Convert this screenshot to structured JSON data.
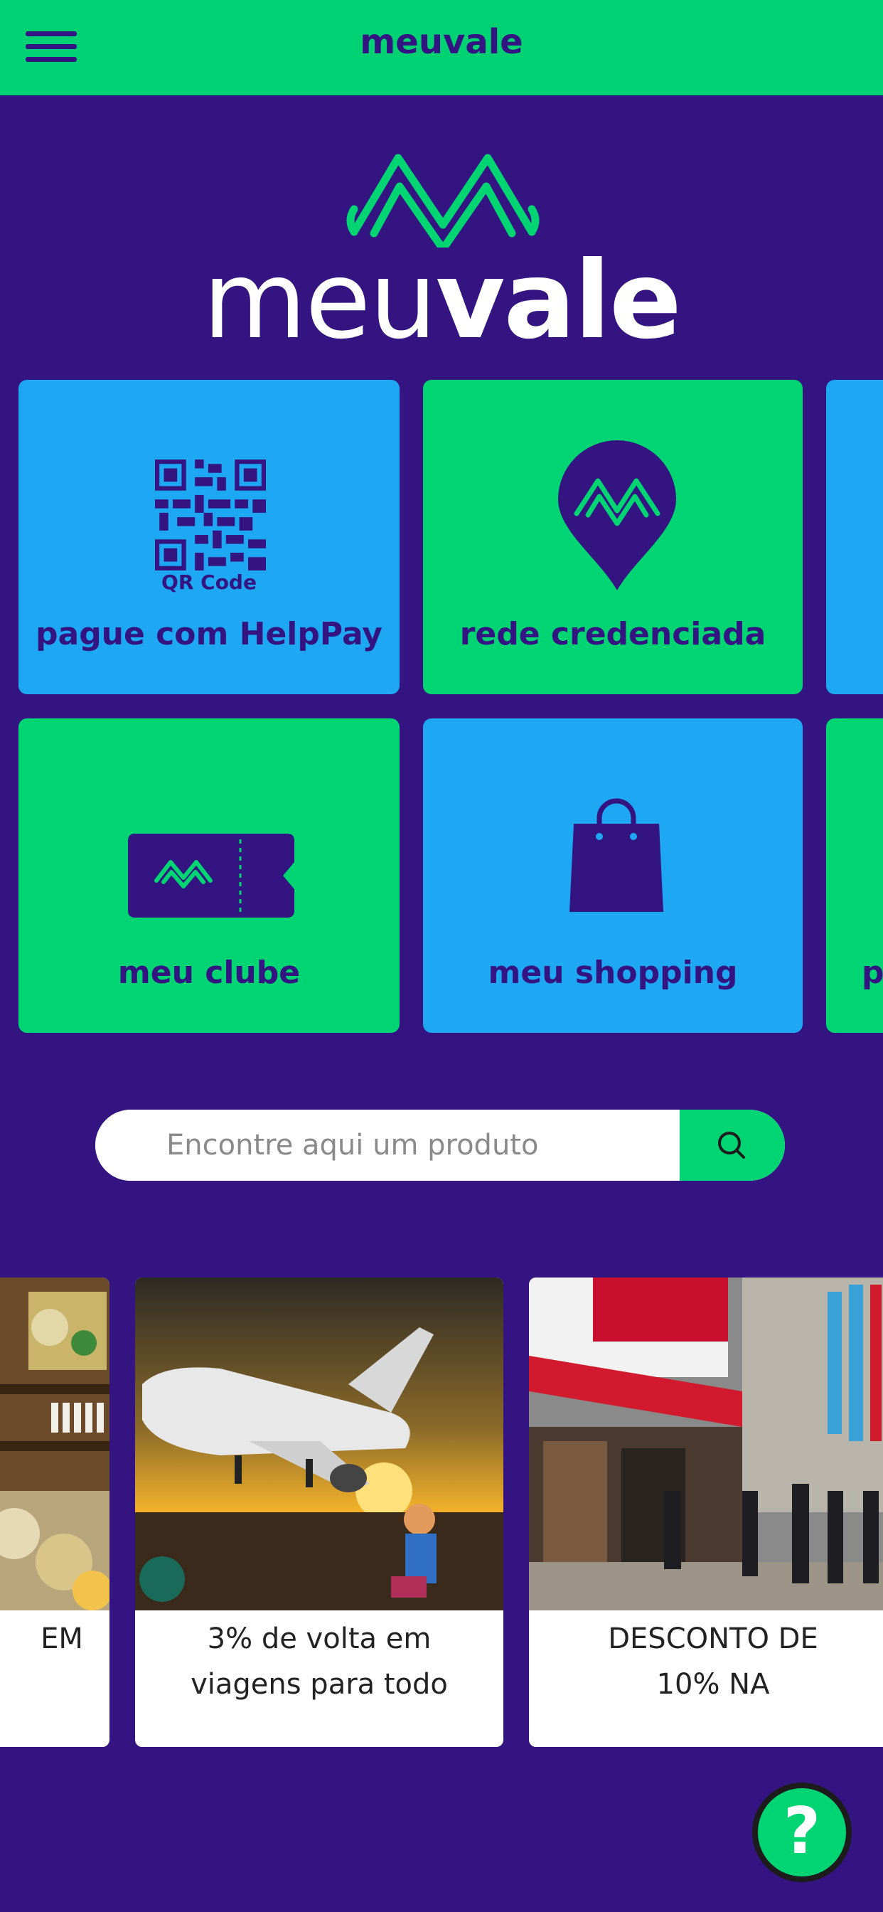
{
  "header": {
    "title": "meuvale"
  },
  "logo": {
    "word_light": "meu",
    "word_bold": "vale"
  },
  "tiles": [
    {
      "label": "pague com HelpPay",
      "icon": "qr-code-icon",
      "icon_caption": "QR Code",
      "color": "#1EA8F4"
    },
    {
      "label": "rede credenciada",
      "icon": "location-pin-icon",
      "color": "#00D473"
    },
    {
      "label": "meu clube",
      "icon": "ticket-icon",
      "color": "#00D473"
    },
    {
      "label": "meu shopping",
      "icon": "shopping-bag-icon",
      "color": "#1EA8F4"
    },
    {
      "label": "p",
      "color": "#00D473"
    }
  ],
  "search": {
    "placeholder": "Encontre aqui um produto",
    "icon": "search-icon"
  },
  "promos": [
    {
      "line1": "EM",
      "line2": ""
    },
    {
      "line1": "3% de volta em",
      "line2": "viagens para todo"
    },
    {
      "line1": "DESCONTO DE",
      "line2": "10% NA"
    }
  ],
  "help": {
    "label": "?"
  },
  "colors": {
    "background": "#341481",
    "green": "#00D473",
    "blue": "#1EA8F4"
  }
}
